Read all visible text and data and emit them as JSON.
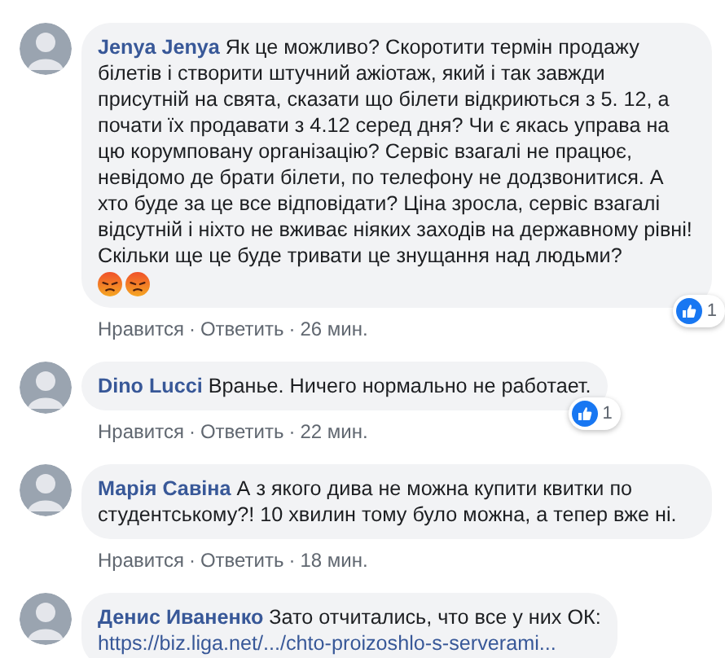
{
  "separator": "·",
  "comments": [
    {
      "author": "Jenya Jenya",
      "text": "Як це можливо? Скоротити термін продажу білетів і створити штучний ажіотаж, який і так завжди присутній на свята, сказати що білети відкриються з 5. 12, а почати їх продавати з 4.12 серед дня? Чи є якась управа на цю корумповану організацію? Сервіс взагалі не працює, невідомо де брати білети, по телефону не додзвонитися. А хто буде за це все відповідати? Ціна зросла, сервіс взагалі відсутній і ніхто не вживає ніяких заходів на державному рівні! Скільки ще це буде тривати це знущання над людьми?",
      "emojis": [
        {
          "kind": "angry"
        },
        {
          "kind": "angry"
        }
      ],
      "likes": "1",
      "actions": [
        "Нравится",
        "Ответить",
        "26 мин."
      ]
    },
    {
      "author": "Dino Lucci",
      "text": "Вранье. Ничего нормально не работает.",
      "likes": "1",
      "actions": [
        "Нравится",
        "Ответить",
        "22 мин."
      ]
    },
    {
      "author": "Марія Савіна",
      "text": "А з якого дива не можна купити квитки по студентському?! 10 хвилин тому було можна, а тепер вже ні.",
      "actions": [
        "Нравится",
        "Ответить",
        "18 мин."
      ]
    },
    {
      "author": "Денис Иваненко",
      "text": "Зато отчитались, что все у них ОК:",
      "link": "https://biz.liga.net/.../chto-proizoshlo-s-serverami..."
    }
  ]
}
